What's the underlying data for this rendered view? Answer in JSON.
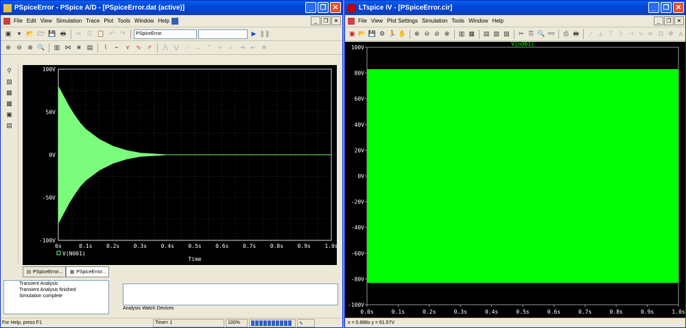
{
  "pspice": {
    "title": "PSpiceError - PSpice A/D - [PSpiceError.dat (active)]",
    "menu": [
      "File",
      "Edit",
      "View",
      "Simulation",
      "Trace",
      "Plot",
      "Tools",
      "Window",
      "Help"
    ],
    "profile_field": "PSpiceError",
    "profile_field2": "",
    "plot": {
      "y_ticks": [
        "100V",
        "50V",
        "0V",
        "-50V",
        "-100V"
      ],
      "x_ticks": [
        "0s",
        "0.1s",
        "0.2s",
        "0.3s",
        "0.4s",
        "0.5s",
        "0.6s",
        "0.7s",
        "0.8s",
        "0.9s",
        "1.0s"
      ],
      "xlabel": "Time",
      "legend": "V(N001)",
      "plot_bg": "#000000",
      "trace_color": "#7cfc7c"
    },
    "tabs": [
      "PSpiceError...",
      "PSpiceError..."
    ],
    "output_lines": [
      "Transient Analysis",
      "Transient Analysis finished",
      "Simulation complete"
    ],
    "bottom_tabs": [
      "Analysis",
      "Watch",
      "Devices"
    ],
    "status": {
      "help": "For Help, press F1",
      "time": "Time= 1",
      "zoom": "100%"
    }
  },
  "ltspice": {
    "title": "LTspice IV - [PSpiceError.cir]",
    "menu": [
      "File",
      "View",
      "Plot Settings",
      "Simulation",
      "Tools",
      "Window",
      "Help"
    ],
    "plot": {
      "trace_label": "V(n001)",
      "y_ticks": [
        "100V",
        "80V",
        "60V",
        "40V",
        "20V",
        "0V",
        "-20V",
        "-40V",
        "-60V",
        "-80V",
        "-100V"
      ],
      "x_ticks": [
        "0.0s",
        "0.1s",
        "0.2s",
        "0.3s",
        "0.4s",
        "0.5s",
        "0.6s",
        "0.7s",
        "0.8s",
        "0.9s",
        "1.0s"
      ],
      "fill_color": "#00ff00",
      "plot_bg": "#000000"
    },
    "status": "x = 0.888s   y = 61.57V"
  },
  "chart_data": [
    {
      "type": "area",
      "x": [
        0,
        0.01,
        0.02,
        0.04,
        0.06,
        0.08,
        0.1,
        0.15,
        0.2,
        0.25,
        0.3,
        0.35,
        0.4,
        1.0
      ],
      "series": [
        {
          "name": "V(N001)",
          "upper": [
            80,
            74,
            68,
            56,
            46,
            37,
            30,
            18,
            10,
            5,
            2,
            1,
            0,
            0
          ],
          "lower": [
            -80,
            -74,
            -68,
            -56,
            -46,
            -37,
            -30,
            -18,
            -10,
            -5,
            -2,
            -1,
            0,
            0
          ]
        }
      ],
      "xlabel": "Time",
      "ylim": [
        -100,
        100
      ],
      "xlim": [
        0,
        1.0
      ],
      "grid": true
    },
    {
      "type": "area",
      "x": [
        0,
        1.0
      ],
      "series": [
        {
          "name": "V(n001)",
          "upper": [
            83,
            83
          ],
          "lower": [
            -83,
            -83
          ]
        }
      ],
      "ylim": [
        -100,
        100
      ],
      "xlim": [
        0,
        1.0
      ],
      "grid": false
    }
  ]
}
